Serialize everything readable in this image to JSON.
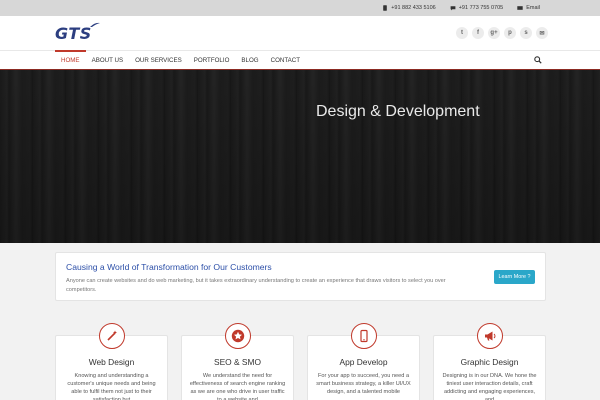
{
  "topbar": {
    "phone1": "+91 882 433 5106",
    "phone2": "+91 773 755 0705",
    "email_label": "Email"
  },
  "logo": {
    "text": "GTS"
  },
  "socials": [
    {
      "icon": "twitter-icon",
      "glyph": "t"
    },
    {
      "icon": "facebook-icon",
      "glyph": "f"
    },
    {
      "icon": "google-plus-icon",
      "glyph": "g+"
    },
    {
      "icon": "pinterest-icon",
      "glyph": "p"
    },
    {
      "icon": "skype-icon",
      "glyph": "s"
    },
    {
      "icon": "email-icon",
      "glyph": "✉"
    }
  ],
  "nav": {
    "items": [
      "HOME",
      "ABOUT US",
      "OUR SERVICES",
      "PORTFOLIO",
      "BLOG",
      "CONTACT"
    ],
    "active": "HOME"
  },
  "hero": {
    "title": "Design & Development"
  },
  "cta": {
    "title": "Causing a World of Transformation for Our Customers",
    "text": "Anyone can create websites and do web marketing, but it takes extraordinary understanding to create an experience that draws visitors to select you over competitors.",
    "button": "Learn More ?"
  },
  "services": [
    {
      "title": "Web Design",
      "icon": "magic-wand-icon",
      "text": "Knowing and understanding a customer's unique needs and being able to fulfil them not just to their satisfaction but"
    },
    {
      "title": "SEO & SMO",
      "icon": "star-icon",
      "text": "We understand the need for effectiveness of search engine ranking as we are one who drive in user traffic to a website and"
    },
    {
      "title": "App Develop",
      "icon": "mobile-phone-icon",
      "text": "For your app to succeed, you need a smart business strategy, a killer UI/UX design, and a talented mobile"
    },
    {
      "title": "Graphic Design",
      "icon": "megaphone-icon",
      "text": "Designing is in our DNA. We hone the tiniest user interaction details, craft addicting and engaging experiences, and"
    }
  ],
  "colors": {
    "accent": "#c0392b",
    "brand": "#2c3e80",
    "button": "#2aa7c9",
    "link": "#2c4fa8"
  }
}
